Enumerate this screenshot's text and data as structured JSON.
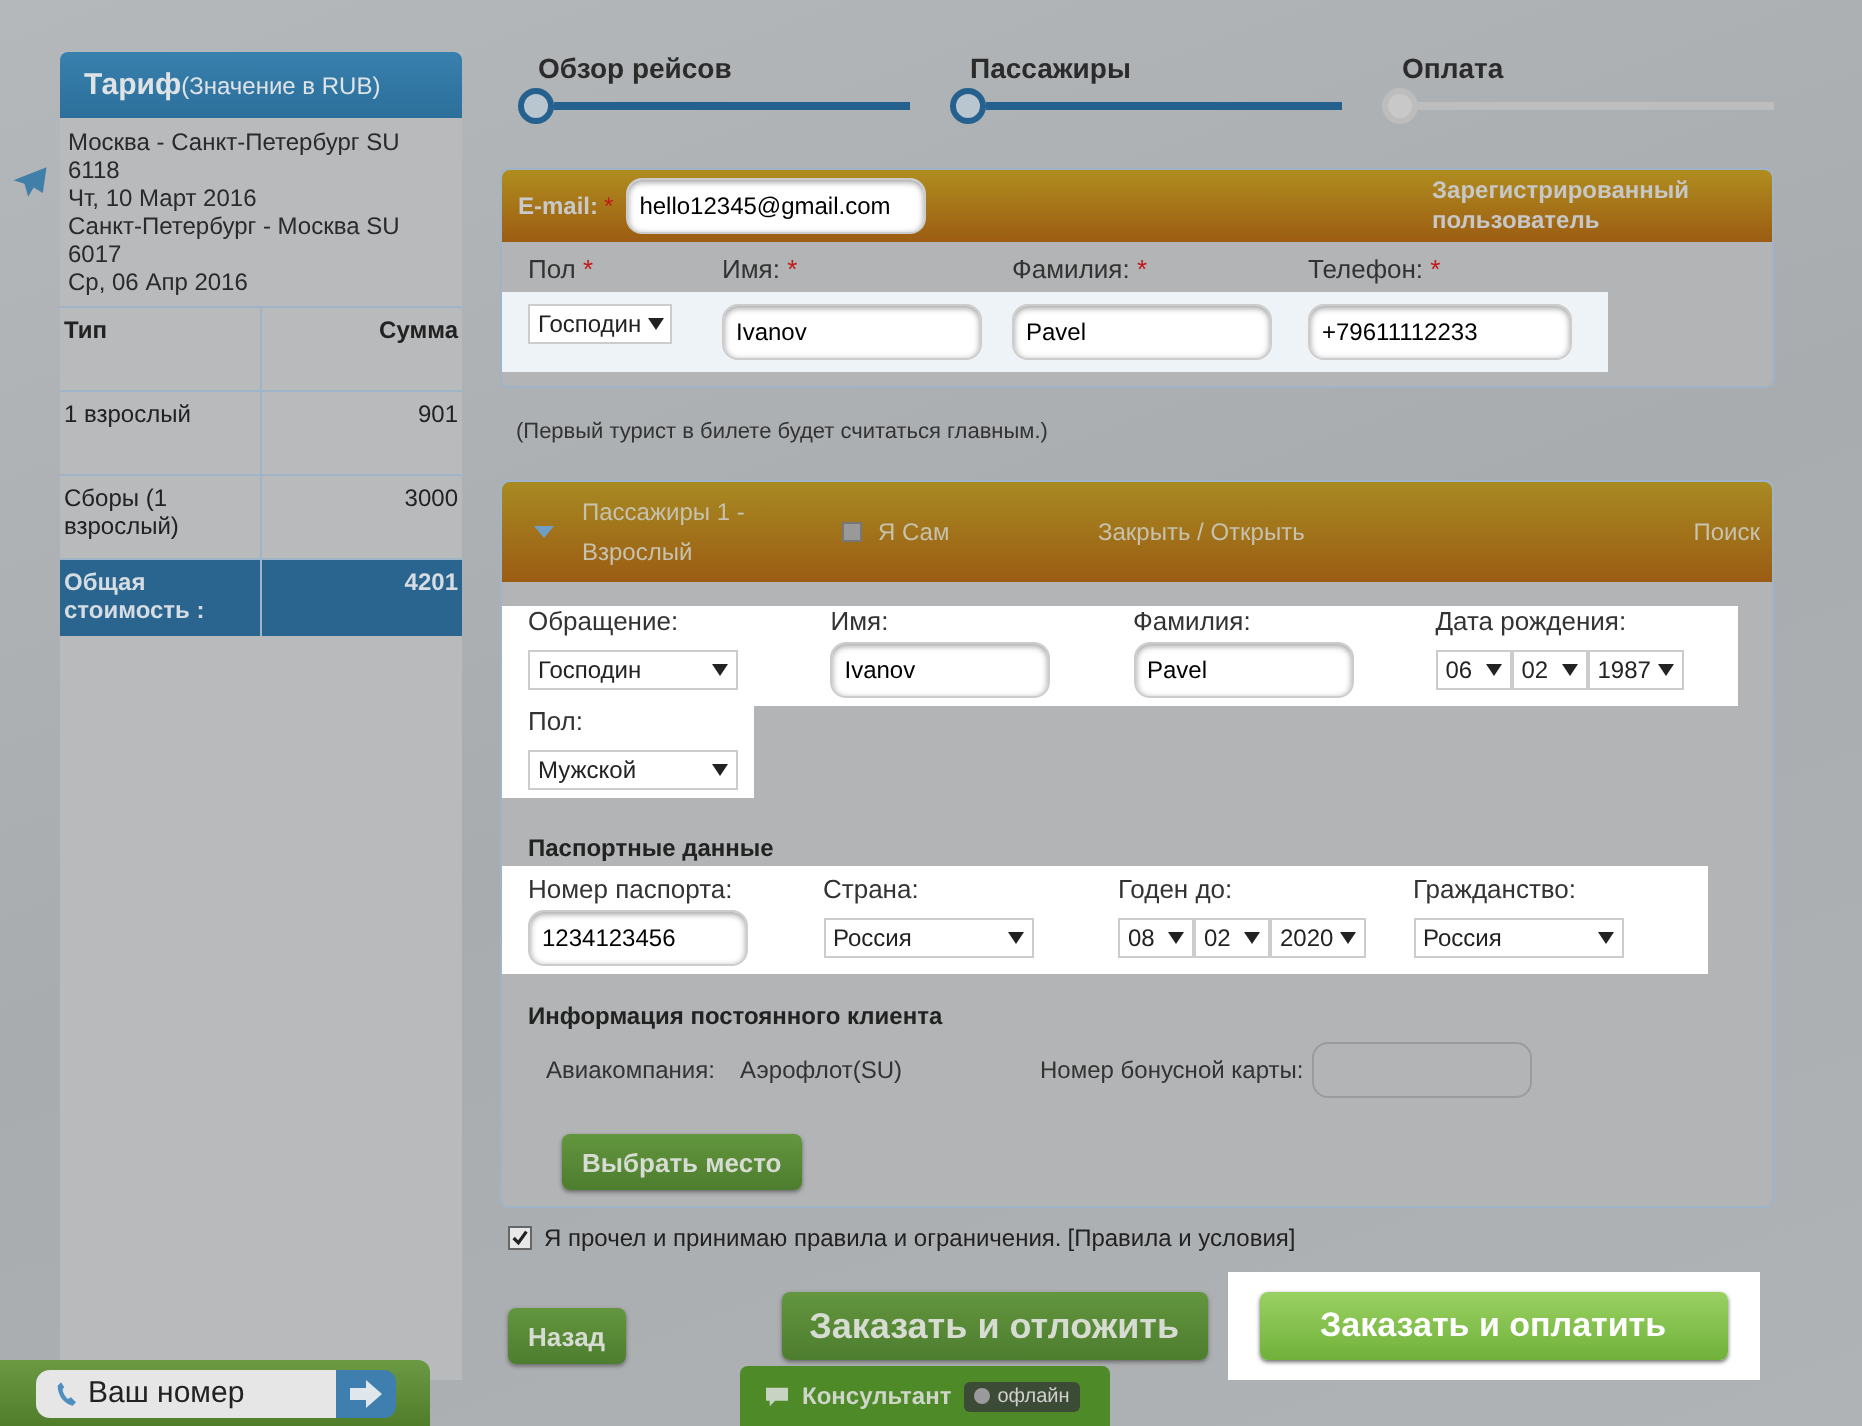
{
  "tariff": {
    "title": "Тариф",
    "subtitle": "(Значение в RUB)",
    "flights": [
      "Москва - Санкт-Петербург SU 6118",
      "Чт, 10 Март 2016",
      "Санкт-Петербург - Москва SU 6017",
      "Ср, 06 Апр 2016"
    ],
    "columns": [
      "Тип",
      "Сумма"
    ],
    "rows": [
      {
        "type": "1 взрослый",
        "sum": "901"
      },
      {
        "type": "Сборы (1 взрослый)",
        "sum": "3000"
      }
    ],
    "total": {
      "label": "Общая стоимость :",
      "sum": "4201"
    }
  },
  "steps": [
    {
      "label": "Обзор рейсов",
      "done": true
    },
    {
      "label": "Пассажиры",
      "done": true
    },
    {
      "label": "Оплата",
      "done": false
    }
  ],
  "contact": {
    "email_label": "E-mail:",
    "required_mark": "*",
    "email": "hello12345@gmail.com",
    "registered": "Зарегистрированный пользователь",
    "fields": [
      {
        "label": "Пол",
        "kind": "select",
        "value": "Господин"
      },
      {
        "label": "Имя:",
        "kind": "input",
        "value": "Ivanov"
      },
      {
        "label": "Фамилия:",
        "kind": "input",
        "value": "Pavel"
      },
      {
        "label": "Телефон:",
        "kind": "input",
        "value": "+79611112233"
      }
    ]
  },
  "note": "(Первый турист в билете будет считаться главным.)",
  "passenger": {
    "title": "Пассажиры 1 - Взрослый",
    "self_label": "Я Сам",
    "self_checked": false,
    "toggle": "Закрыть / Открыть",
    "search": "Поиск",
    "rows": [
      [
        {
          "label": "Обращение:",
          "kind": "select",
          "value": "Господин"
        },
        {
          "label": "Имя:",
          "kind": "input",
          "value": "Ivanov"
        },
        {
          "label": "Фамилия:",
          "kind": "input",
          "value": "Pavel"
        },
        {
          "label": "Дата рождения:",
          "kind": "date",
          "values": [
            "06",
            "02",
            "1987"
          ]
        }
      ],
      [
        {
          "label": "Пол:",
          "kind": "select",
          "value": "Мужской"
        }
      ]
    ],
    "passport_title": "Паспортные данные",
    "passport": [
      {
        "label": "Номер паспорта:",
        "kind": "input",
        "value": "1234123456"
      },
      {
        "label": "Страна:",
        "kind": "select",
        "value": "Россия"
      },
      {
        "label": "Годен до:",
        "kind": "date",
        "values": [
          "08",
          "02",
          "2020"
        ]
      },
      {
        "label": "Гражданство:",
        "kind": "select",
        "value": "Россия"
      }
    ],
    "loyalty_title": "Информация постоянного клиента",
    "airline_label": "Авиакомпания:",
    "airline": "Аэрофлот(SU)",
    "card_label": "Номер бонусной карты:",
    "seat_button": "Выбрать место"
  },
  "terms": {
    "checked": true,
    "text": "Я прочел и принимаю правила и ограничения.",
    "link": "[Правила и условия]"
  },
  "buttons": {
    "back": "Назад",
    "hold": "Заказать и отложить",
    "pay": "Заказать и оплатить"
  },
  "callback": {
    "placeholder": "Ваш номер"
  },
  "chat": {
    "label": "Консультант",
    "status": "офлайн"
  }
}
